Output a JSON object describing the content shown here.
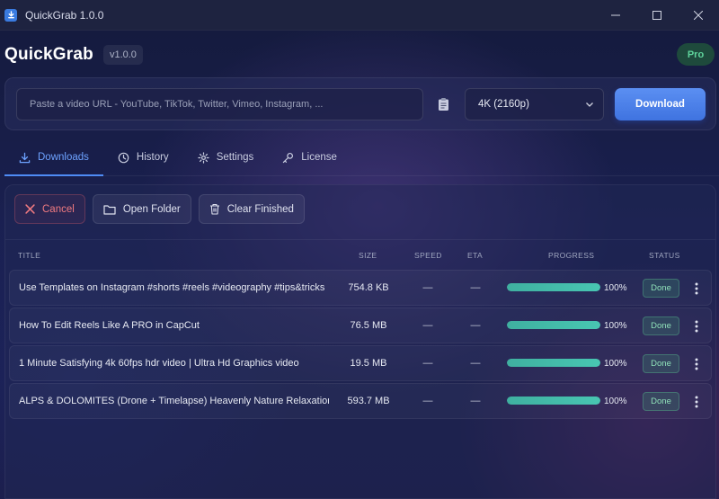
{
  "window": {
    "title": "QuickGrab 1.0.0"
  },
  "header": {
    "app_name": "QuickGrab",
    "version": "v1.0.0",
    "plan_badge": "Pro"
  },
  "url_bar": {
    "value": "",
    "placeholder": "Paste a video URL - YouTube, TikTok, Twitter, Vimeo, Instagram, ...",
    "quality_selected": "4K (2160p)",
    "download_label": "Download",
    "paste_icon": "clipboard-icon"
  },
  "tabs": [
    {
      "label": "Downloads",
      "icon": "download-icon",
      "active": true
    },
    {
      "label": "History",
      "icon": "clock-icon",
      "active": false
    },
    {
      "label": "Settings",
      "icon": "gear-icon",
      "active": false
    },
    {
      "label": "License",
      "icon": "key-icon",
      "active": false
    }
  ],
  "toolbar": {
    "cancel_label": "Cancel",
    "open_folder_label": "Open Folder",
    "clear_finished_label": "Clear Finished"
  },
  "table": {
    "columns": {
      "title": "TITLE",
      "size": "SIZE",
      "speed": "SPEED",
      "eta": "ETA",
      "progress": "PROGRESS",
      "status": "STATUS"
    },
    "rows": [
      {
        "title": "Use Templates on Instagram #shorts #reels #videography #tips&tricks",
        "size": "754.8 KB",
        "speed": "—",
        "eta": "—",
        "progress": 100,
        "progress_label": "100%",
        "status": "Done"
      },
      {
        "title": "How To Edit Reels Like A PRO in CapCut",
        "size": "76.5 MB",
        "speed": "—",
        "eta": "—",
        "progress": 100,
        "progress_label": "100%",
        "status": "Done"
      },
      {
        "title": "1 Minute Satisfying 4k 60fps hdr video | Ultra Hd Graphics video",
        "size": "19.5 MB",
        "speed": "—",
        "eta": "—",
        "progress": 100,
        "progress_label": "100%",
        "status": "Done"
      },
      {
        "title": "ALPS & DOLOMITES (Drone + Timelapse) Heavenly Nature Relaxation™...",
        "size": "593.7 MB",
        "speed": "—",
        "eta": "—",
        "progress": 100,
        "progress_label": "100%",
        "status": "Done"
      }
    ]
  },
  "colors": {
    "accent": "#4f8cf5",
    "progress": "#48c6b2",
    "done": "#8fe0b8",
    "cancel": "#f07a80",
    "pro": "#5fd49c"
  }
}
